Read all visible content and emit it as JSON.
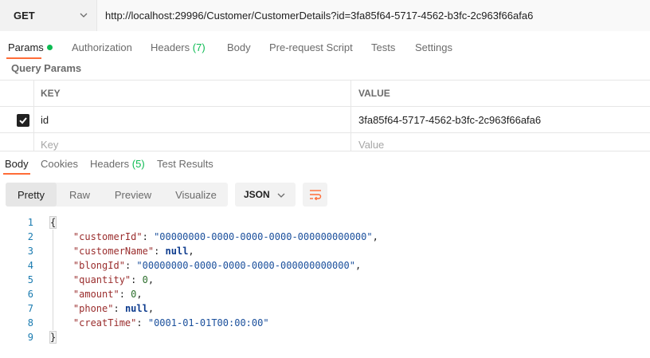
{
  "request": {
    "method": "GET",
    "url": "http://localhost:29996/Customer/CustomerDetails?id=3fa85f64-5717-4562-b3fc-2c963f66afa6"
  },
  "request_tabs": [
    {
      "label": "Params",
      "count": ""
    },
    {
      "label": "Authorization",
      "count": ""
    },
    {
      "label": "Headers",
      "count": "(7)"
    },
    {
      "label": "Body",
      "count": ""
    },
    {
      "label": "Pre-request Script",
      "count": ""
    },
    {
      "label": "Tests",
      "count": ""
    },
    {
      "label": "Settings",
      "count": ""
    }
  ],
  "query_params": {
    "section_label": "Query Params",
    "headers": {
      "key": "KEY",
      "value": "VALUE"
    },
    "rows": [
      {
        "key": "id",
        "value": "3fa85f64-5717-4562-b3fc-2c963f66afa6",
        "checked": true
      }
    ],
    "placeholder": {
      "key": "Key",
      "value": "Value"
    }
  },
  "response_tabs": [
    {
      "label": "Body",
      "count": ""
    },
    {
      "label": "Cookies",
      "count": ""
    },
    {
      "label": "Headers",
      "count": "(5)"
    },
    {
      "label": "Test Results",
      "count": ""
    }
  ],
  "view_modes": [
    "Pretty",
    "Raw",
    "Preview",
    "Visualize"
  ],
  "format": "JSON",
  "response_body": {
    "open_brace": "{",
    "close_brace": "}",
    "fields": [
      {
        "key": "\"customerId\"",
        "value": "\"00000000-0000-0000-0000-000000000000\"",
        "type": "string",
        "sep": ","
      },
      {
        "key": "\"customerName\"",
        "value": "null",
        "type": "null",
        "sep": ","
      },
      {
        "key": "\"blongId\"",
        "value": "\"00000000-0000-0000-0000-000000000000\"",
        "type": "string",
        "sep": ","
      },
      {
        "key": "\"quantity\"",
        "value": "0",
        "type": "number",
        "sep": ","
      },
      {
        "key": "\"amount\"",
        "value": "0",
        "type": "number",
        "sep": ","
      },
      {
        "key": "\"phone\"",
        "value": "null",
        "type": "null",
        "sep": ","
      },
      {
        "key": "\"creatTime\"",
        "value": "\"0001-01-01T00:00:00\"",
        "type": "string",
        "sep": ""
      }
    ],
    "line_numbers": [
      "1",
      "2",
      "3",
      "4",
      "5",
      "6",
      "7",
      "8",
      "9"
    ]
  },
  "colors": {
    "accent": "#ff6c37",
    "count_green": "#0cbb52"
  }
}
